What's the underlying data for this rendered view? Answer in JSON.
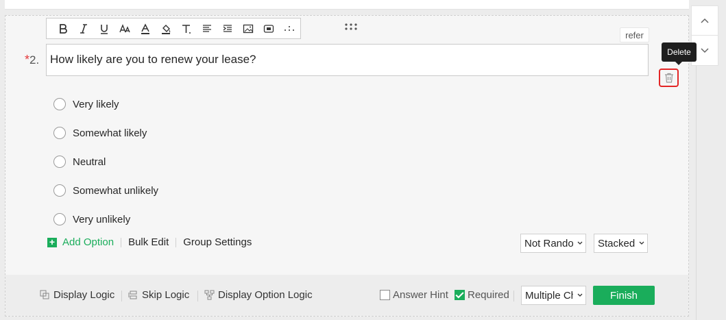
{
  "question": {
    "required_mark": "*",
    "number": "2.",
    "text": "How likely are you to renew your lease?"
  },
  "toolbar": {
    "buttons": [
      "bold-icon",
      "italic-icon",
      "underline-icon",
      "font-size-icon",
      "font-color-icon",
      "fill-color-icon",
      "clear-format-icon",
      "align-icon",
      "indent-icon",
      "image-icon",
      "media-icon",
      "more-icon"
    ]
  },
  "refer_label": "refer",
  "tooltip_label": "Delete",
  "options": [
    "Very likely",
    "Somewhat likely",
    "Neutral",
    "Somewhat unlikely",
    "Very unlikely"
  ],
  "option_actions": {
    "add_option": "Add Option",
    "bulk_edit": "Bulk Edit",
    "group_settings": "Group Settings"
  },
  "selects": {
    "randomize": "Not Random",
    "layout": "Stacked",
    "question_type": "Multiple Choice"
  },
  "footer": {
    "display_logic": "Display Logic",
    "skip_logic": "Skip Logic",
    "display_option_logic": "Display Option Logic",
    "answer_hint": "Answer Hint",
    "answer_hint_checked": false,
    "required": "Required",
    "required_checked": true,
    "finish": "Finish"
  },
  "colors": {
    "accent": "#1aad5b",
    "danger": "#e32626",
    "required": "#e4393c"
  }
}
